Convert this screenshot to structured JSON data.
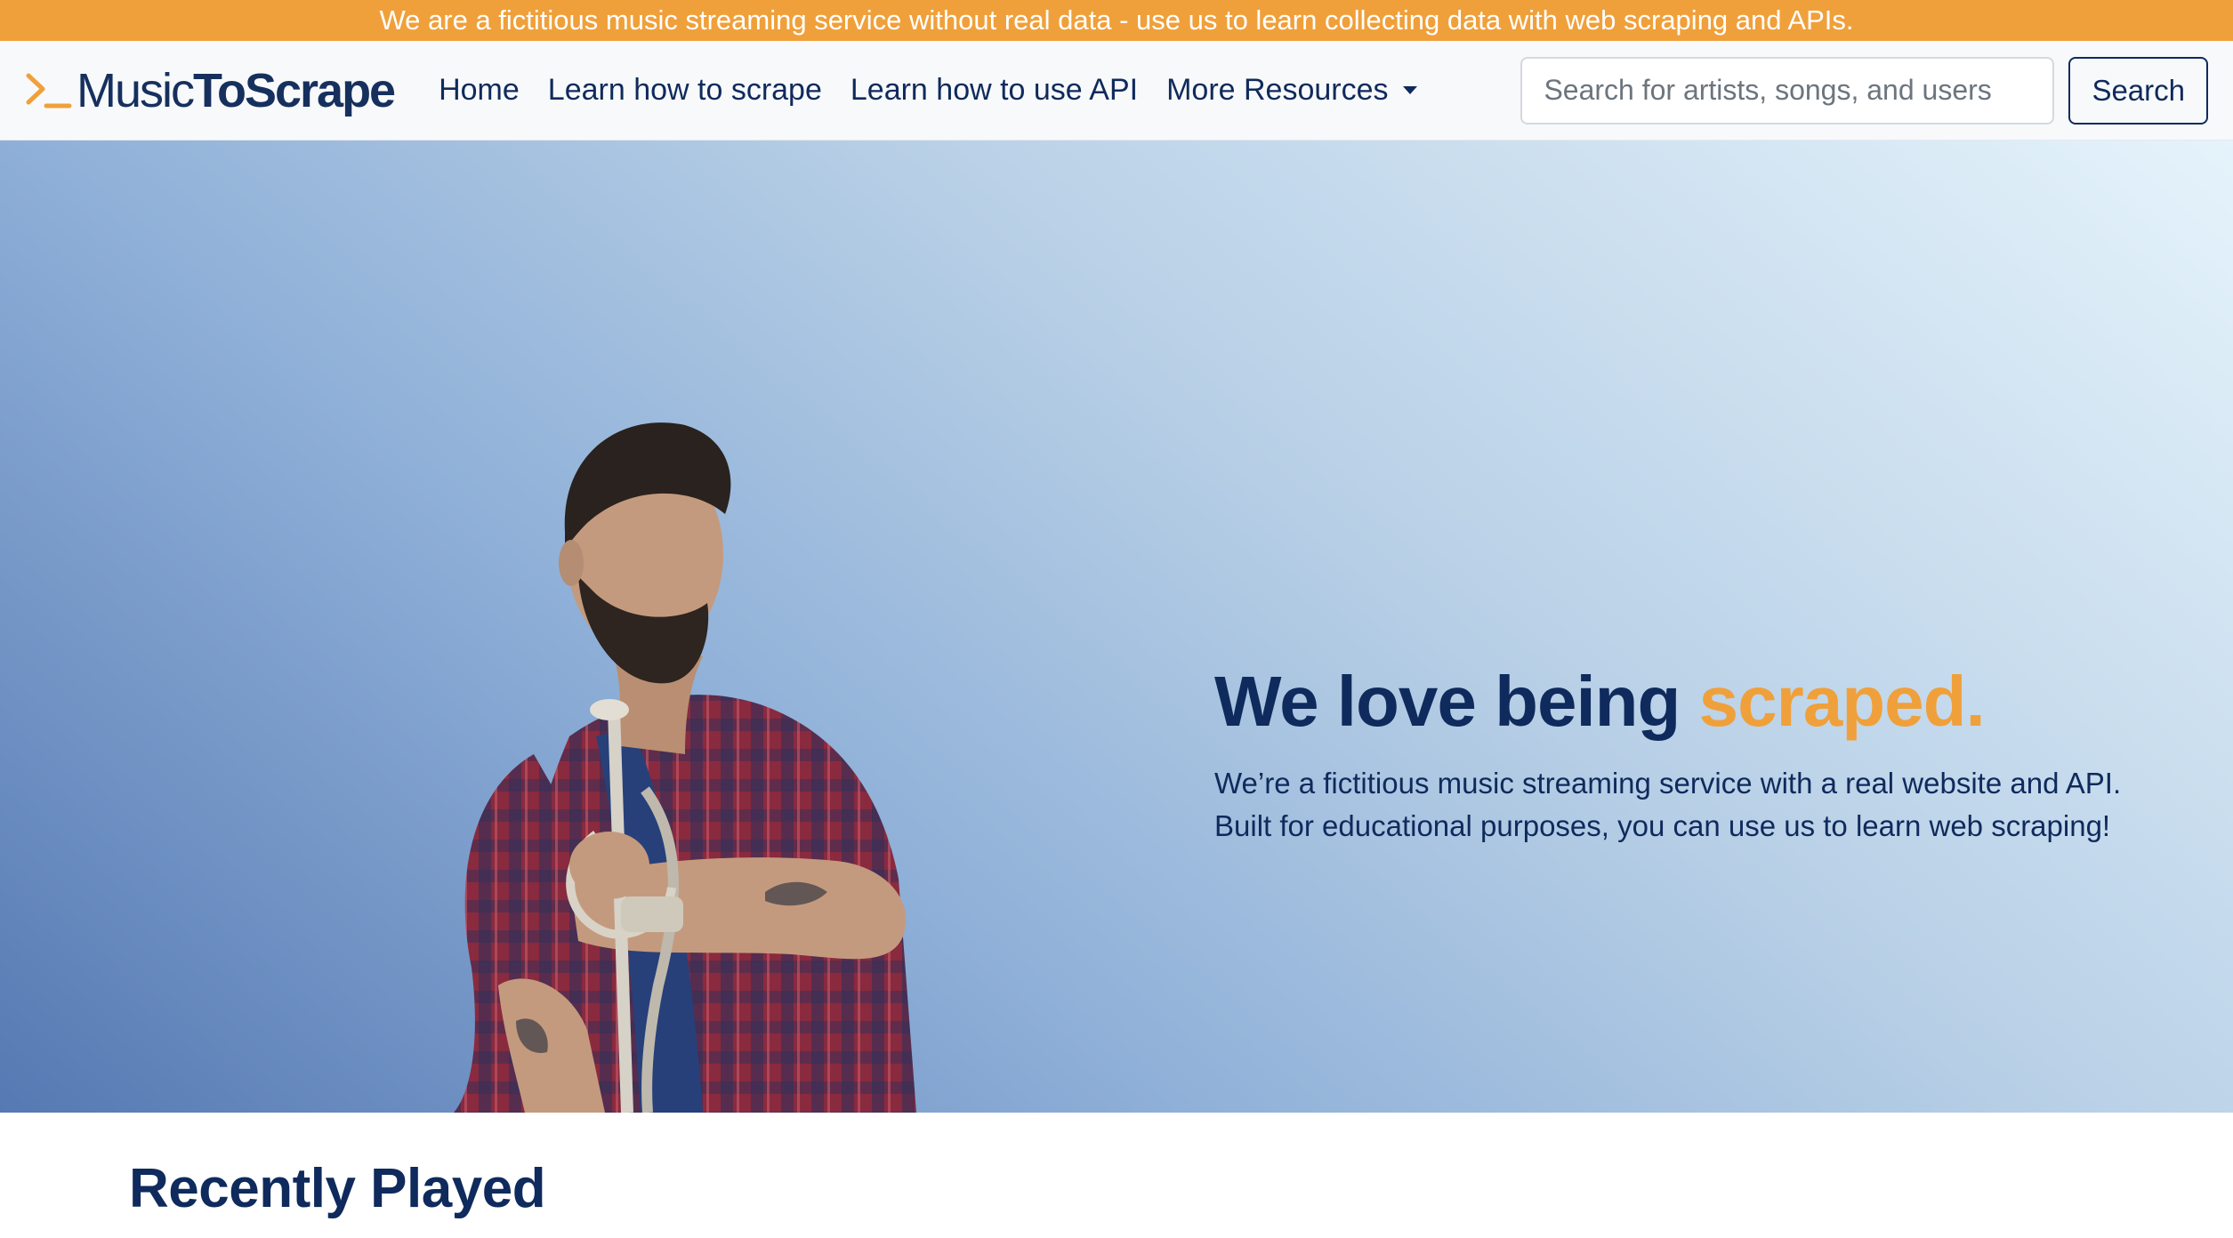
{
  "announcement": {
    "text": "We are a fictitious music streaming service without real data - use us to learn collecting data with web scraping and APIs."
  },
  "navbar": {
    "brand": {
      "part1": "Music",
      "part2": "ToScrape"
    },
    "links": [
      {
        "label": "Home"
      },
      {
        "label": "Learn how to scrape"
      },
      {
        "label": "Learn how to use API"
      },
      {
        "label": "More Resources"
      }
    ],
    "search": {
      "placeholder": "Search for artists, songs, and users",
      "value": "",
      "button_label": "Search"
    }
  },
  "hero": {
    "title_main": "We love being ",
    "title_accent": "scraped.",
    "subtitle_line1": "We’re a fictitious music streaming service with a real website and API.",
    "subtitle_line2": "Built for educational purposes, you can use us to learn web scraping!"
  },
  "recently_played": {
    "title": "Recently Played"
  },
  "colors": {
    "accent": "#f0a03a",
    "navy": "#0f2a5c",
    "navbar_bg": "#f8f9fa"
  },
  "icons": {
    "brand_icon": "terminal-prompt-icon",
    "dropdown_icon": "caret-down-icon"
  }
}
